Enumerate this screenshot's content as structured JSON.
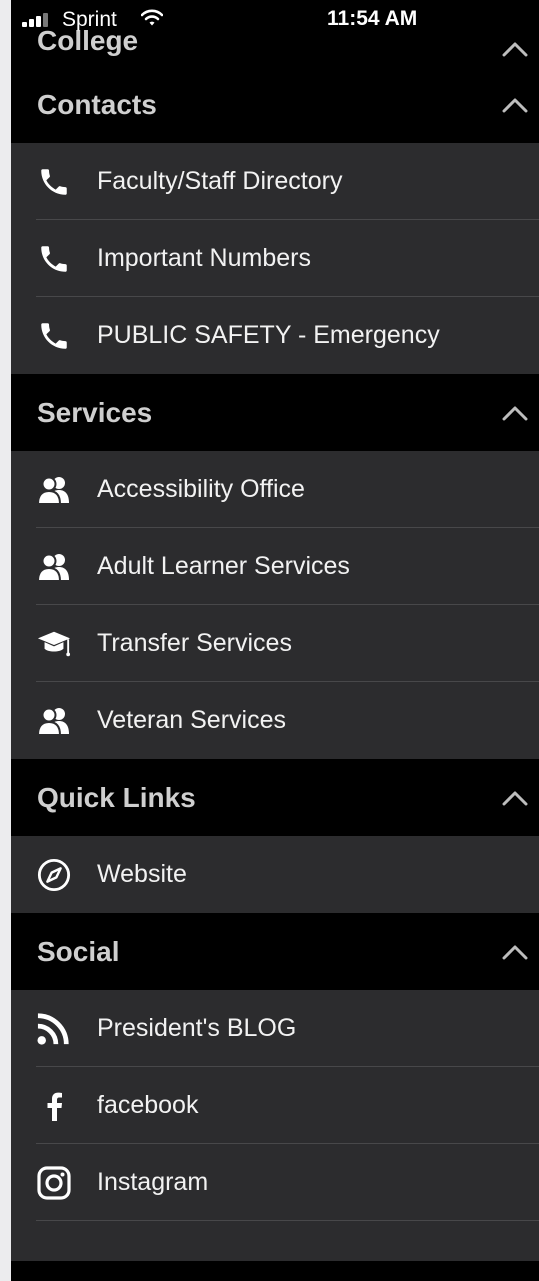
{
  "status_bar": {
    "carrier": "Sprint",
    "time": "11:54 AM"
  },
  "sections": [
    {
      "title": "College",
      "items": []
    },
    {
      "title": "Contacts",
      "items": [
        {
          "label": "Faculty/Staff Directory",
          "icon": "phone-icon"
        },
        {
          "label": "Important Numbers",
          "icon": "phone-icon"
        },
        {
          "label": "PUBLIC SAFETY - Emergency",
          "icon": "phone-icon"
        }
      ]
    },
    {
      "title": "Services",
      "items": [
        {
          "label": "Accessibility Office",
          "icon": "users-icon"
        },
        {
          "label": "Adult Learner Services",
          "icon": "users-icon"
        },
        {
          "label": "Transfer Services",
          "icon": "graduation-cap-icon"
        },
        {
          "label": "Veteran Services",
          "icon": "users-icon"
        }
      ]
    },
    {
      "title": "Quick Links",
      "items": [
        {
          "label": "Website",
          "icon": "compass-icon"
        }
      ]
    },
    {
      "title": "Social",
      "items": [
        {
          "label": "President's BLOG",
          "icon": "rss-icon"
        },
        {
          "label": "facebook",
          "icon": "facebook-icon"
        },
        {
          "label": "Instagram",
          "icon": "instagram-icon"
        }
      ]
    }
  ],
  "colors": {
    "header_bg": "#000000",
    "item_bg": "#2c2c2e",
    "header_text": "#cfcfcf",
    "item_text": "#f2f2f2",
    "separator": "#48484a"
  }
}
